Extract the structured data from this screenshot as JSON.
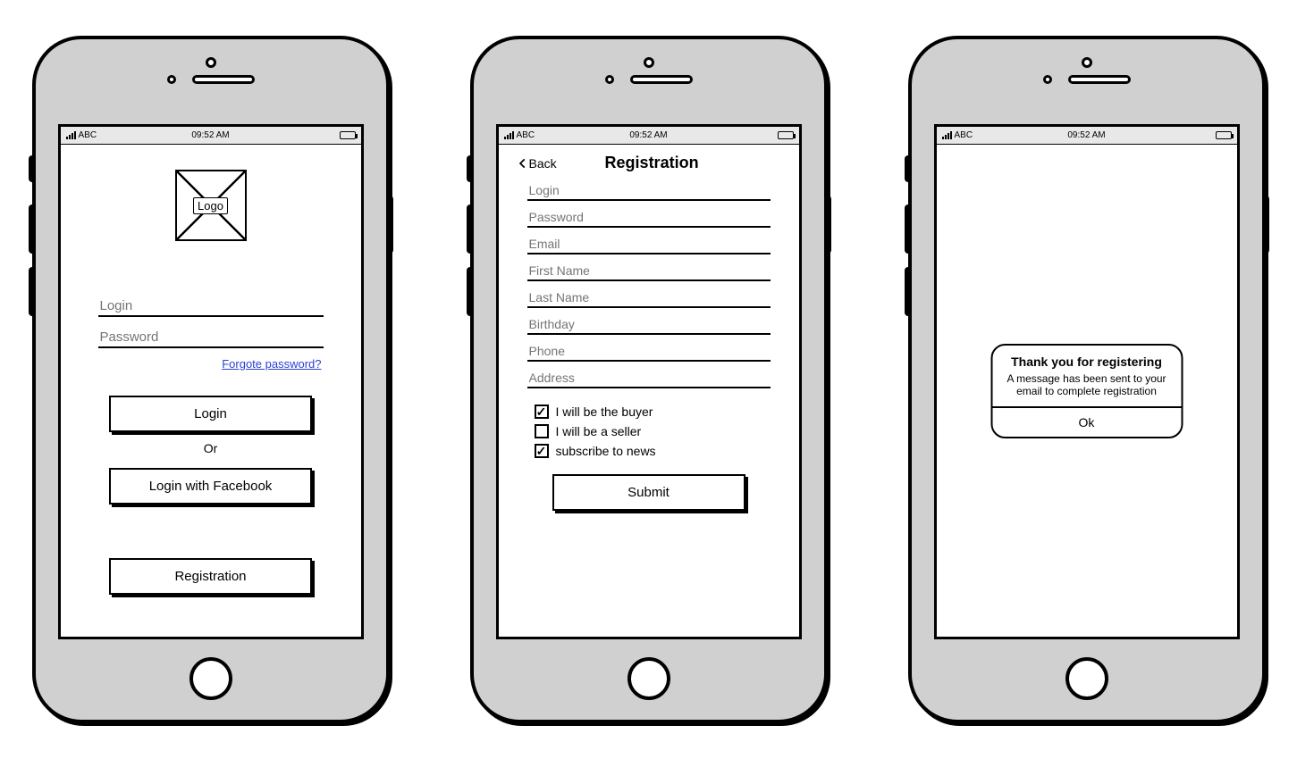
{
  "statusbar": {
    "carrier": "ABC",
    "time": "09:52 AM"
  },
  "screen1": {
    "logo_label": "Logo",
    "login_placeholder": "Login",
    "password_placeholder": "Password",
    "forgot_link": "Forgote password?",
    "login_btn": "Login",
    "or_label": "Or",
    "login_fb_btn": "Login with Facebook",
    "registration_btn": "Registration"
  },
  "screen2": {
    "back_label": "Back",
    "title": "Registration",
    "fields": {
      "login": "Login",
      "password": "Password",
      "email": "Email",
      "first_name": "First Name",
      "last_name": "Last Name",
      "birthday": "Birthday",
      "phone": "Phone",
      "address": "Address"
    },
    "checks": {
      "buyer": {
        "label": "I will be the buyer",
        "checked": true
      },
      "seller": {
        "label": "I will be a seller",
        "checked": false
      },
      "news": {
        "label": "subscribe to news",
        "checked": true
      }
    },
    "submit_btn": "Submit"
  },
  "screen3": {
    "title": "Thank you for registering",
    "message": "A message has been sent to your email to complete registration",
    "ok_label": "Ok"
  }
}
